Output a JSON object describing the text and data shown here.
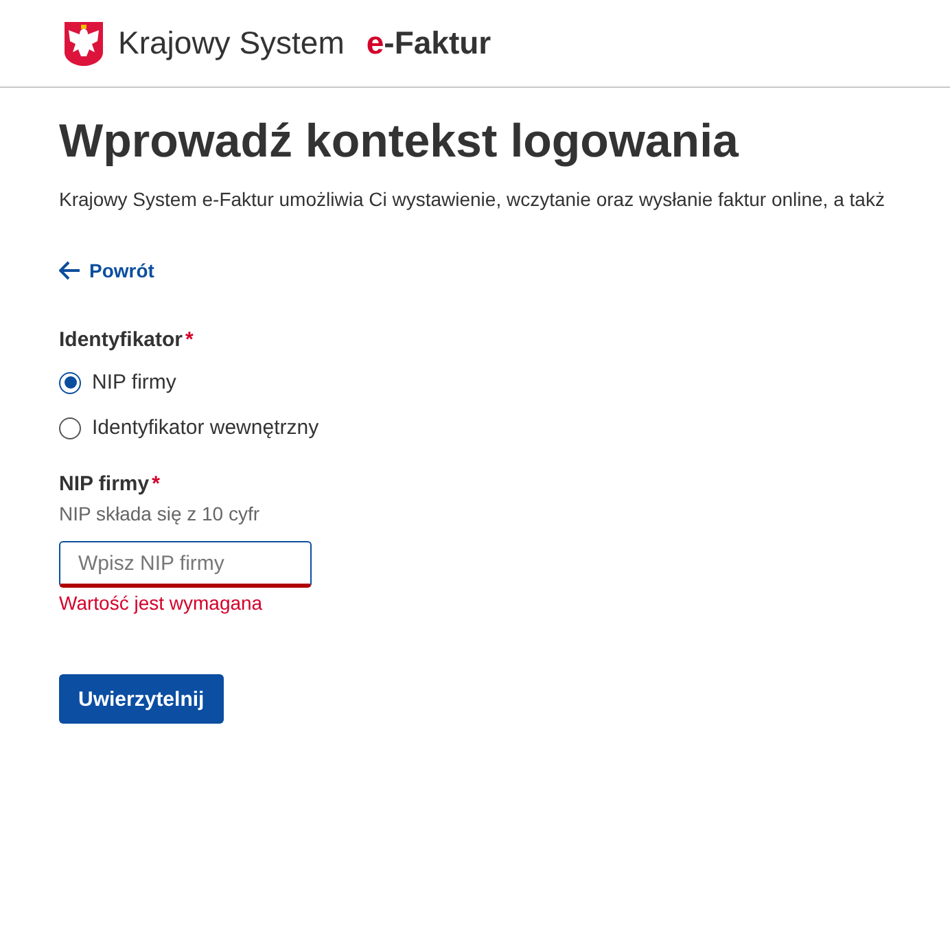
{
  "header": {
    "logo_text": "Krajowy System",
    "logo_accent": "e",
    "logo_suffix": "-Faktur"
  },
  "page": {
    "title": "Wprowadź kontekst logowania",
    "description": "Krajowy System e-Faktur umożliwia Ci wystawienie, wczytanie oraz wysłanie faktur online, a takż",
    "back_link": "Powrót"
  },
  "identifier": {
    "label": "Identyfikator",
    "required_mark": "*",
    "options": [
      {
        "label": "NIP firmy",
        "selected": true
      },
      {
        "label": "Identyfikator wewnętrzny",
        "selected": false
      }
    ]
  },
  "nip_field": {
    "label": "NIP firmy",
    "required_mark": "*",
    "hint": "NIP składa się z 10 cyfr",
    "placeholder": "Wpisz NIP firmy",
    "invalid": true,
    "error": "Wartość jest wymagana"
  },
  "submit_button": "Uwierzytelnij"
}
